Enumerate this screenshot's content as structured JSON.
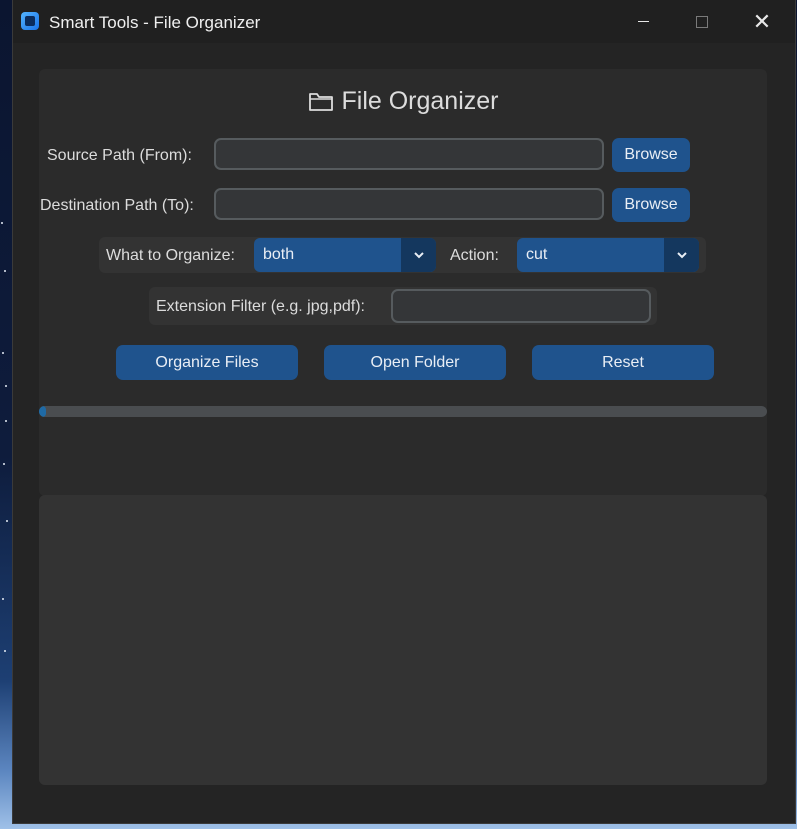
{
  "window": {
    "title": "Smart Tools - File Organizer"
  },
  "header": {
    "title": "File Organizer"
  },
  "source": {
    "label": "Source Path (From):",
    "value": "",
    "browse_label": "Browse"
  },
  "destination": {
    "label": "Destination Path (To):",
    "value": "",
    "browse_label": "Browse"
  },
  "organize": {
    "label": "What to Organize:",
    "selected": "both"
  },
  "action": {
    "label": "Action:",
    "selected": "cut"
  },
  "filter": {
    "label": "Extension Filter (e.g. jpg,pdf):",
    "value": ""
  },
  "buttons": {
    "organize": "Organize Files",
    "open_folder": "Open Folder",
    "reset": "Reset"
  },
  "progress": {
    "value": 0.01
  },
  "log": {
    "text": ""
  },
  "colors": {
    "accent": "#1f538d",
    "accent_dark": "#14375e",
    "progress_fill": "#1f6aa5",
    "window_bg": "#242424",
    "panel_bg": "#2b2b2b"
  },
  "icons": {
    "app": "app-icon",
    "header": "folder-icon",
    "dropdown": "chevron-down-icon"
  }
}
